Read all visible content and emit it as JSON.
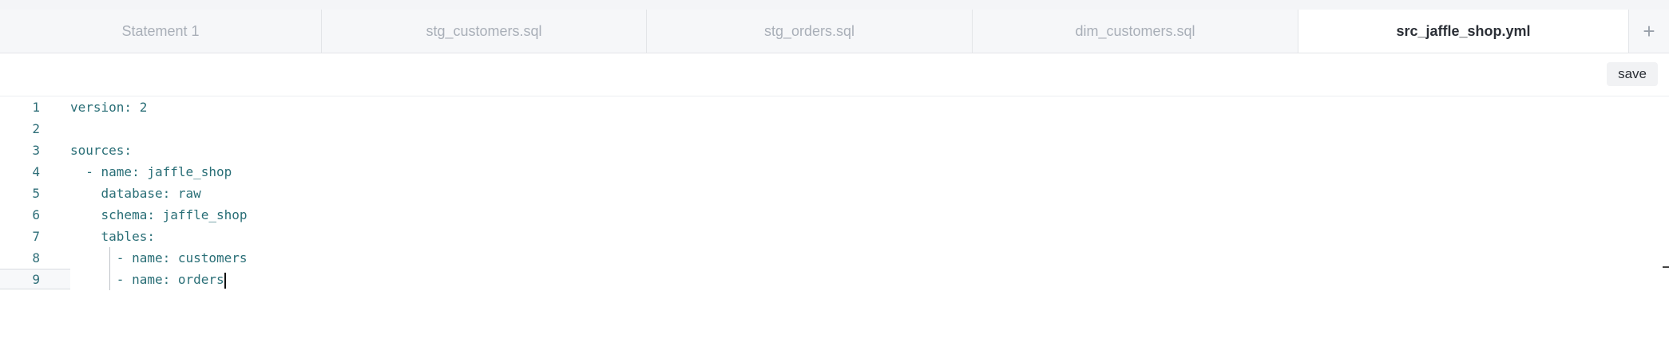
{
  "tabs": [
    {
      "label": "Statement 1",
      "active": false
    },
    {
      "label": "stg_customers.sql",
      "active": false
    },
    {
      "label": "stg_orders.sql",
      "active": false
    },
    {
      "label": "dim_customers.sql",
      "active": false
    },
    {
      "label": "src_jaffle_shop.yml",
      "active": true
    }
  ],
  "add_tab_label": "+",
  "toolbar": {
    "save_label": "save"
  },
  "editor": {
    "lines": [
      {
        "number": "1",
        "text": "version: 2"
      },
      {
        "number": "2",
        "text": ""
      },
      {
        "number": "3",
        "text": "sources:"
      },
      {
        "number": "4",
        "text": "  - name: jaffle_shop"
      },
      {
        "number": "5",
        "text": "    database: raw"
      },
      {
        "number": "6",
        "text": "    schema: jaffle_shop"
      },
      {
        "number": "7",
        "text": "    tables:"
      },
      {
        "number": "8",
        "text": "      - name: customers"
      },
      {
        "number": "9",
        "text": "      - name: orders"
      }
    ]
  }
}
